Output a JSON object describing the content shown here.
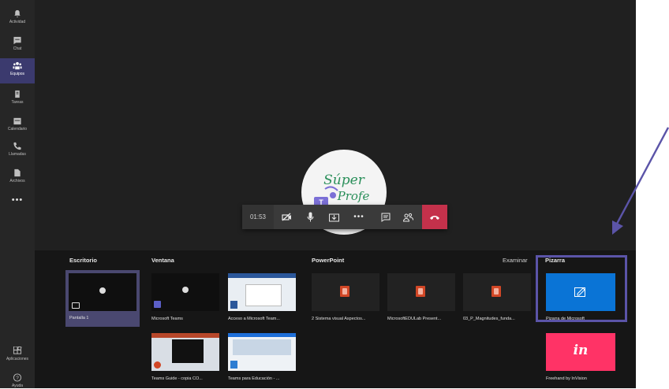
{
  "rail": {
    "items": [
      {
        "label": "Actividad",
        "icon": "bell-icon"
      },
      {
        "label": "Chat",
        "icon": "chat-icon"
      },
      {
        "label": "Equipos",
        "icon": "teams-icon",
        "active": true
      },
      {
        "label": "Tareas",
        "icon": "assignments-icon"
      },
      {
        "label": "Calendario",
        "icon": "calendar-icon"
      },
      {
        "label": "Llamadas",
        "icon": "phone-icon"
      },
      {
        "label": "Archivos",
        "icon": "files-icon"
      }
    ],
    "more": "•••",
    "apps_label": "Aplicaciones",
    "help_label": "Ayuda"
  },
  "avatar": {
    "text_line1": "Súper",
    "text_line2": "Profe"
  },
  "callbar": {
    "timer": "01:53",
    "icons": [
      "camera-off-icon",
      "microphone-icon",
      "share-tray-icon",
      "more-icon",
      "chat-icon",
      "participants-icon",
      "hangup-icon"
    ]
  },
  "tray": {
    "sections": {
      "desktop": "Escritorio",
      "window": "Ventana",
      "powerpoint": "PowerPoint",
      "browse": "Examinar",
      "whiteboard": "Pizarra"
    },
    "desktop_items": [
      {
        "label": "Pantalla 1"
      }
    ],
    "window_items": [
      {
        "label": "Microsoft Teams"
      },
      {
        "label": "Acceso a Microsoft Team..."
      },
      {
        "label": "Teams Guide - copia CO..."
      },
      {
        "label": "Teams para Educación - ..."
      }
    ],
    "ppt_items": [
      {
        "label": "2 Sistema visual Aspectos..."
      },
      {
        "label": "MicrosoftEDULab Present..."
      },
      {
        "label": "03_P_Magnitudes_funda..."
      }
    ],
    "whiteboard_items": [
      {
        "label": "Pizarra de Microsoft",
        "color": "#0a74d6"
      },
      {
        "label": "Freehand by InVision",
        "glyph": "in",
        "color": "#ff3366"
      }
    ]
  },
  "colors": {
    "accent": "#5b54a8",
    "hangup": "#c4314b",
    "powerpoint": "#d24726"
  }
}
